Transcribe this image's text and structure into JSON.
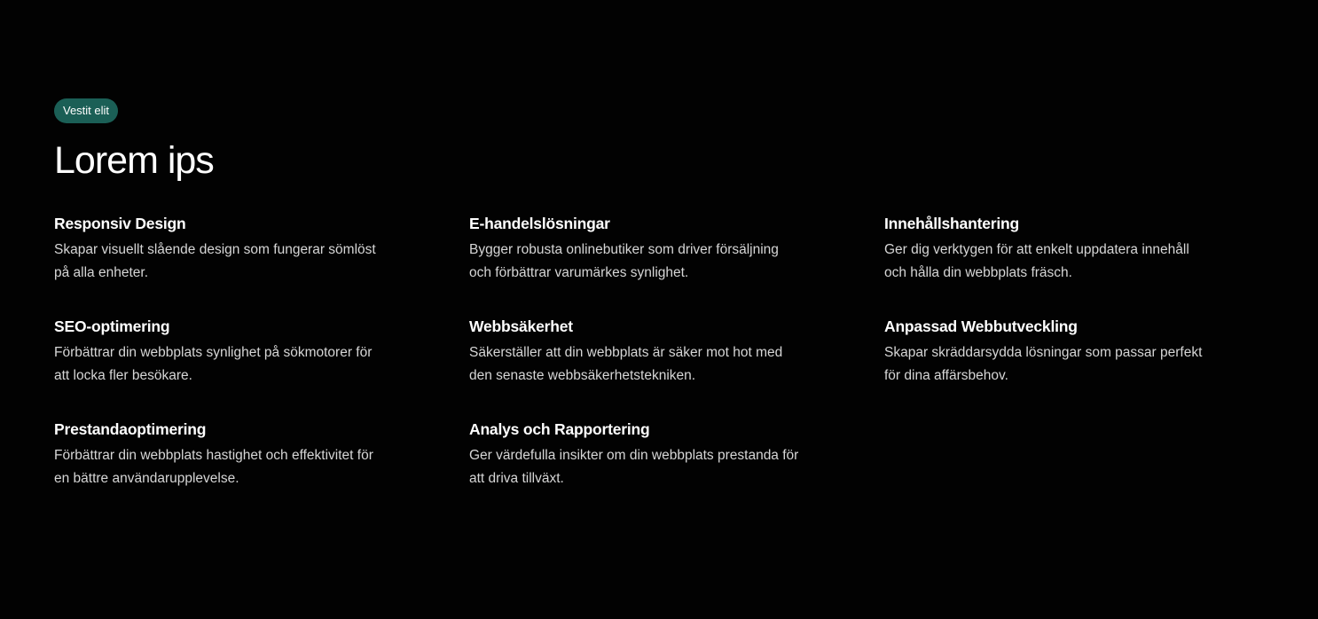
{
  "section": {
    "badge": "Vestit elit",
    "title": "Lorem ips"
  },
  "features": [
    {
      "title": "Responsiv Design",
      "desc_line1": "Skapar visuellt slående design som fungerar sömlöst",
      "desc_line2": "på alla enheter."
    },
    {
      "title": "E-handelslösningar",
      "desc_line1": "Bygger robusta onlinebutiker som driver försäljning",
      "desc_line2": "och förbättrar varumärkes synlighet."
    },
    {
      "title": "Innehållshantering",
      "desc_line1": "Ger dig verktygen för att enkelt uppdatera innehåll",
      "desc_line2": "och hålla din webbplats fräsch."
    },
    {
      "title": "SEO-optimering",
      "desc_line1": "Förbättrar din webbplats synlighet på sökmotorer för",
      "desc_line2": "att locka fler besökare."
    },
    {
      "title": "Webbsäkerhet",
      "desc_line1": "Säkerställer att din webbplats är säker mot hot med",
      "desc_line2": "den senaste webbsäkerhetstekniken."
    },
    {
      "title": "Anpassad Webbutveckling",
      "desc_line1": "Skapar skräddarsydda lösningar som passar perfekt",
      "desc_line2": "för dina affärsbehov."
    },
    {
      "title": "Prestandaoptimering",
      "desc_line1": "Förbättrar din webbplats hastighet och effektivitet för",
      "desc_line2": "en bättre användarupplevelse."
    },
    {
      "title": "Analys och Rapportering",
      "desc_line1": "Ger värdefulla insikter om din webbplats prestanda för",
      "desc_line2": "att driva tillväxt."
    }
  ],
  "colors": {
    "background": "#020202",
    "badge_background": "#1b5f56",
    "text_primary": "#ffffff",
    "text_secondary": "#d6d6d6"
  }
}
